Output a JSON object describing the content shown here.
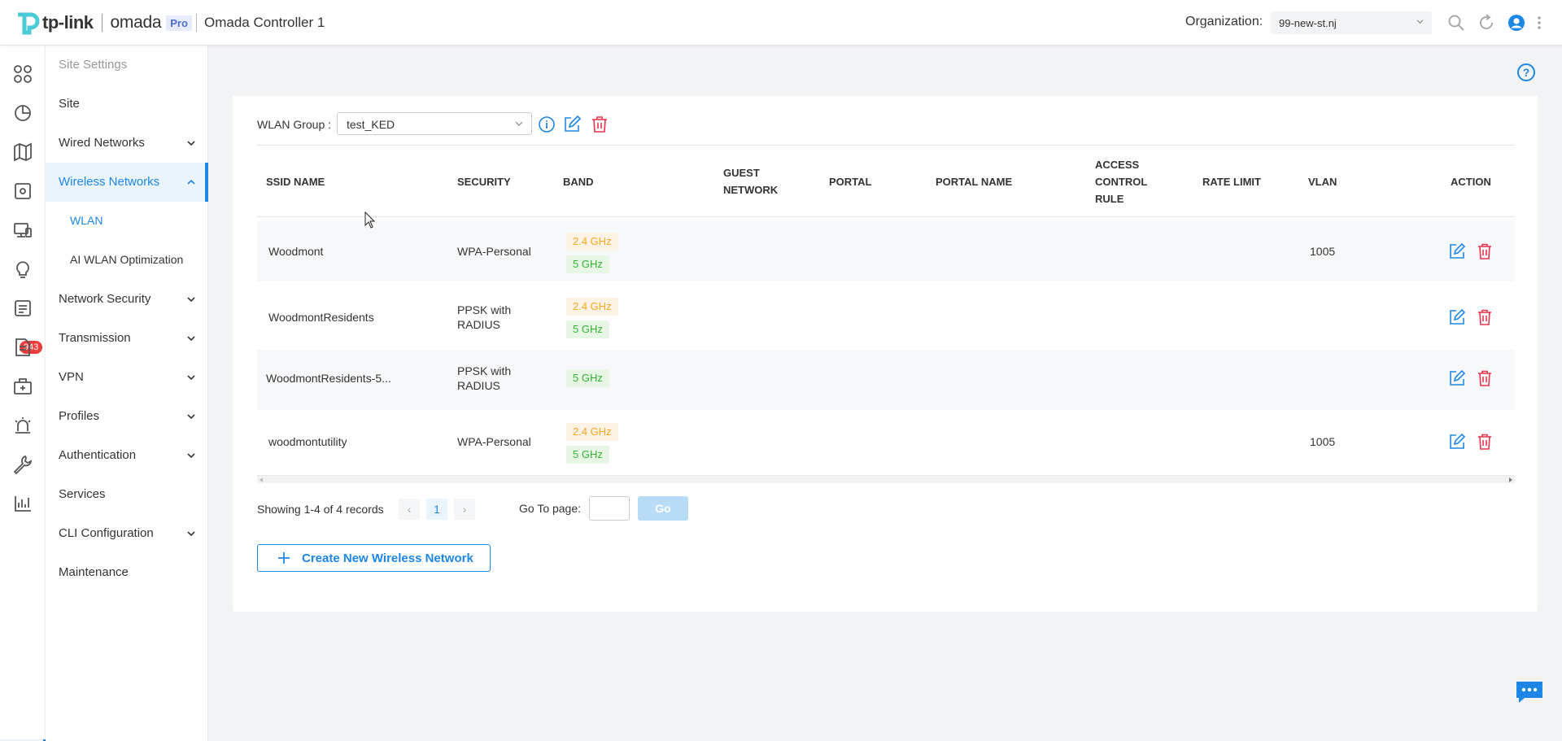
{
  "header": {
    "logo_text": "tp-link",
    "product": "omada",
    "pro_badge": "Pro",
    "controller_name": "Omada Controller 1",
    "org_label": "Organization:",
    "org_value": "99-new-st.nj"
  },
  "rail": {
    "badge_count": "943",
    "icons": [
      "dashboard-icon",
      "statistics-icon",
      "map-icon",
      "devices-icon",
      "clients-icon",
      "insights-icon",
      "logs-icon",
      "reports-icon",
      "toolbox-icon",
      "alert-icon",
      "tools-icon",
      "analytics-icon",
      "settings-icon"
    ]
  },
  "sidebar": {
    "title": "Site Settings",
    "items": [
      {
        "label": "Site",
        "expandable": false
      },
      {
        "label": "Wired Networks",
        "expandable": true
      },
      {
        "label": "Wireless Networks",
        "expandable": true,
        "expanded": true,
        "active": true
      },
      {
        "label": "Network Security",
        "expandable": true
      },
      {
        "label": "Transmission",
        "expandable": true
      },
      {
        "label": "VPN",
        "expandable": true
      },
      {
        "label": "Profiles",
        "expandable": true
      },
      {
        "label": "Authentication",
        "expandable": true
      },
      {
        "label": "Services",
        "expandable": false
      },
      {
        "label": "CLI Configuration",
        "expandable": true
      },
      {
        "label": "Maintenance",
        "expandable": false
      }
    ],
    "subitems": [
      {
        "label": "WLAN",
        "active": true
      },
      {
        "label": "AI WLAN Optimization",
        "active": false
      }
    ]
  },
  "main": {
    "wlan_group_label": "WLAN Group :",
    "wlan_group_value": "test_KED",
    "columns": {
      "ssid": "SSID NAME",
      "security": "SECURITY",
      "band": "BAND",
      "guest_1": "GUEST",
      "guest_2": "NETWORK",
      "portal": "PORTAL",
      "portal_name": "PORTAL NAME",
      "acr_1": "ACCESS",
      "acr_2": "CONTROL",
      "acr_3": "RULE",
      "rate_limit": "RATE LIMIT",
      "vlan": "VLAN",
      "action": "ACTION"
    },
    "rows": [
      {
        "ssid": "Woodmont",
        "security_1": "WPA-Personal",
        "security_2": "",
        "band_24": "2.4 GHz",
        "band_5": "5 GHz",
        "vlan": "1005"
      },
      {
        "ssid": "WoodmontResidents",
        "security_1": "PPSK with",
        "security_2": "RADIUS",
        "band_24": "2.4 GHz",
        "band_5": "5 GHz",
        "vlan": ""
      },
      {
        "ssid": "WoodmontResidents-5...",
        "security_1": "PPSK with",
        "security_2": "RADIUS",
        "band_24": "",
        "band_5": "5 GHz",
        "vlan": ""
      },
      {
        "ssid": "woodmontutility",
        "security_1": "WPA-Personal",
        "security_2": "",
        "band_24": "2.4 GHz",
        "band_5": "5 GHz",
        "vlan": "1005"
      }
    ],
    "pagination": {
      "showing": "Showing 1-4 of 4 records",
      "current_page": "1",
      "goto_label": "Go To page:",
      "goto_value": "",
      "go_label": "Go"
    },
    "create_label": "Create New Wireless Network"
  },
  "colors": {
    "accent": "#1e87e5",
    "danger": "#e8334a",
    "band_24": "#f5a623",
    "band_5": "#31b531"
  }
}
